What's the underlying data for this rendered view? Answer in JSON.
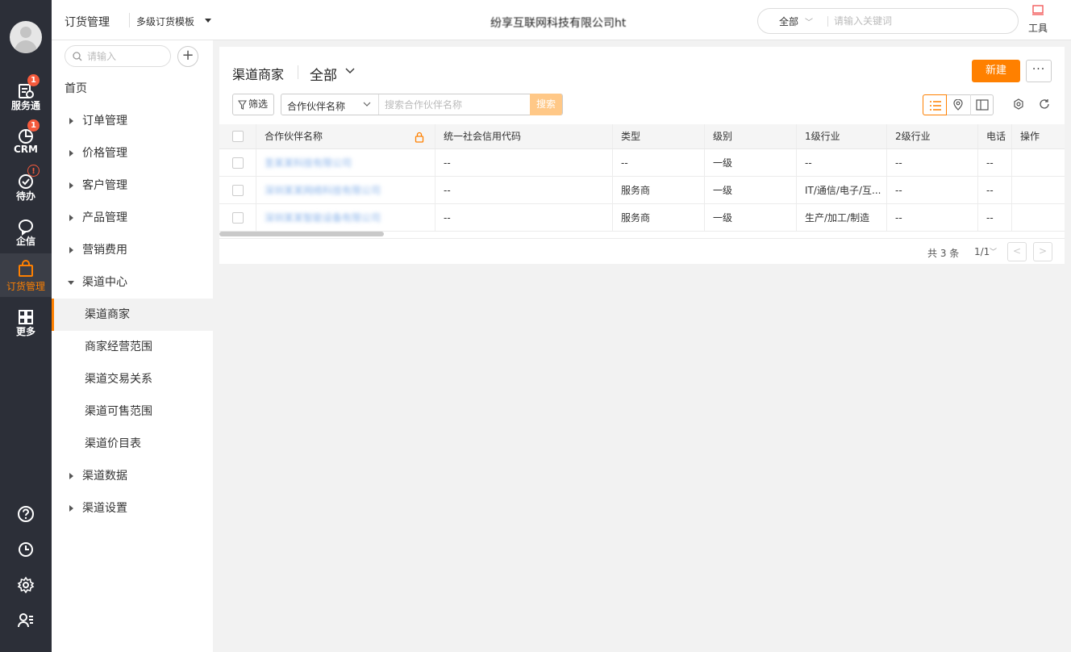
{
  "rail": {
    "items": [
      {
        "label": "服务通",
        "badge": "1"
      },
      {
        "label": "CRM",
        "badge": "1"
      },
      {
        "label": "待办",
        "badge": "!"
      },
      {
        "label": "企信",
        "badge": ""
      },
      {
        "label": "订货管理",
        "badge": ""
      },
      {
        "label": "更多",
        "badge": ""
      }
    ],
    "active_color": "#ff8000"
  },
  "topbar": {
    "app_title": "订货管理",
    "template": "多级订货模板",
    "company": "纷享互联网科技有限公司ht",
    "search_scope": "全部",
    "search_placeholder": "请输入关键词",
    "tools_label": "工具"
  },
  "sidebar": {
    "search_placeholder": "请输入",
    "home": "首页",
    "groups": [
      {
        "label": "订单管理"
      },
      {
        "label": "价格管理"
      },
      {
        "label": "客户管理"
      },
      {
        "label": "产品管理"
      },
      {
        "label": "营销费用"
      },
      {
        "label": "渠道中心"
      }
    ],
    "children": [
      {
        "label": "渠道商家"
      },
      {
        "label": "商家经营范围"
      },
      {
        "label": "渠道交易关系"
      },
      {
        "label": "渠道可售范围"
      },
      {
        "label": "渠道价目表"
      }
    ],
    "groups_after": [
      {
        "label": "渠道数据"
      },
      {
        "label": "渠道设置"
      }
    ]
  },
  "main": {
    "title": "渠道商家",
    "scope": "全部",
    "new_label": "新建",
    "more_label": "···",
    "filter_label": "筛选",
    "field_label": "合作伙伴名称",
    "search_placeholder": "搜索合作伙伴名称",
    "search_button": "搜索"
  },
  "table": {
    "columns": [
      "合作伙伴名称",
      "统一社会信用代码",
      "类型",
      "级别",
      "1级行业",
      "2级行业",
      "电话",
      "操作"
    ],
    "rows": [
      {
        "name": "圣某某科技有限公司",
        "credit_code": "--",
        "type": "--",
        "level": "一级",
        "industry1": "--",
        "industry2": "--",
        "phone": "--"
      },
      {
        "name": "深圳某某网络科技有限公司",
        "credit_code": "--",
        "type": "服务商",
        "level": "一级",
        "industry1": "IT/通信/电子/互...",
        "industry2": "--",
        "phone": "--"
      },
      {
        "name": "深圳某某智能设备有限公司",
        "credit_code": "--",
        "type": "服务商",
        "level": "一级",
        "industry1": "生产/加工/制造",
        "industry2": "--",
        "phone": "--"
      }
    ]
  },
  "pager": {
    "total": "共 3 条",
    "page": "1/1",
    "prev": "<",
    "next": ">"
  }
}
